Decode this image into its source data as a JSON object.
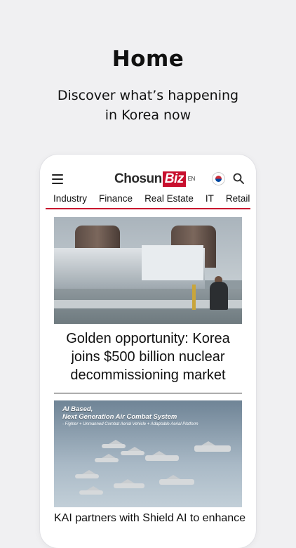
{
  "hero": {
    "title": "Home",
    "subtitle_line1": "Discover what’s happening",
    "subtitle_line2": "in Korea now"
  },
  "app": {
    "logo_text": "Chosun",
    "logo_badge": "Biz",
    "logo_lang": "EN",
    "icons": [
      "menu-icon",
      "korea-flag-icon",
      "search-icon"
    ],
    "accent_color": "#c8102e"
  },
  "tabs": [
    "Industry",
    "Finance",
    "Real Estate",
    "IT",
    "Retail"
  ],
  "articles": [
    {
      "headline": "Golden opportunity: Korea joins $500 billion nuclear decommissioning market"
    },
    {
      "image_caption_line1": "AI Based,",
      "image_caption_line2": "Next Generation Air Combat System",
      "image_caption_line3": "- Fighter + Unmanned Combat Aerial Vehicle + Adaptable Aerial Platform",
      "headline": "KAI partners with Shield AI to enhance"
    }
  ]
}
